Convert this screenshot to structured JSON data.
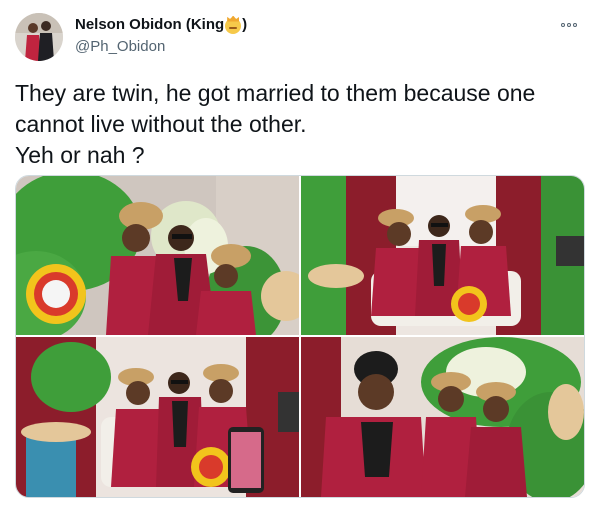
{
  "author": {
    "display_name": "Nelson Obidon (King",
    "display_name_suffix": ")",
    "name_emoji": "crown-face-icon",
    "handle": "@Ph_Obidon"
  },
  "tweet": {
    "text": "They are twin, he got married to them because one\ncannot live without the other.\nYeh or nah ?"
  },
  "media": {
    "photos": [
      {
        "label": "photo-1"
      },
      {
        "label": "photo-2"
      },
      {
        "label": "photo-3"
      },
      {
        "label": "photo-4"
      }
    ]
  },
  "colors": {
    "text": "#0f1419",
    "secondary_text": "#536471",
    "border": "#cfd9de",
    "attire": "#b0203f",
    "foliage": "#3f9e3a",
    "curtain": "#8c1d2b"
  }
}
